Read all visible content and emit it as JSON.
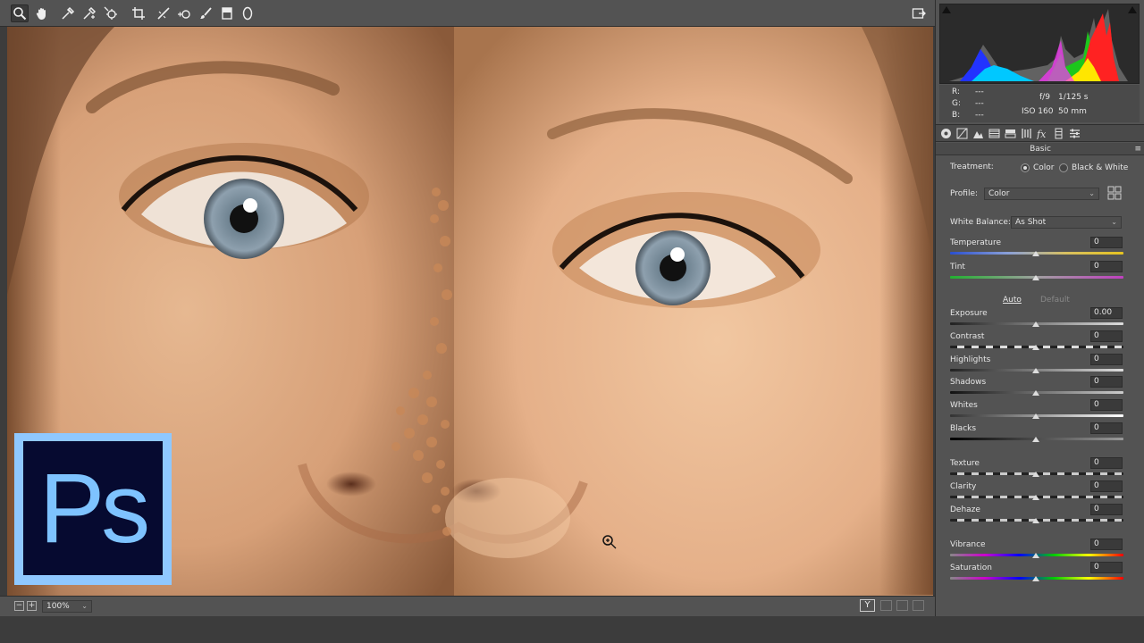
{
  "toolbar": {
    "tools": [
      "zoom-icon",
      "hand-icon",
      "white-balance-icon",
      "color-sampler-icon",
      "targeted-adjustment-icon",
      "crop-icon",
      "straighten-icon",
      "spot-removal-icon",
      "adjustment-brush-icon",
      "graduated-filter-icon",
      "radial-filter-icon"
    ],
    "fullscreen_icon": "fullscreen-toggle-icon"
  },
  "info": {
    "r_label": "R:",
    "r_value": "---",
    "g_label": "G:",
    "g_value": "---",
    "b_label": "B:",
    "b_value": "---",
    "aperture": "f/9",
    "shutter": "1/125 s",
    "iso": "ISO 160",
    "focal": "50 mm"
  },
  "panel_tabs": [
    "basic-tab-icon",
    "tone-curve-tab-icon",
    "detail-tab-icon",
    "hsl-tab-icon",
    "split-toning-tab-icon",
    "lens-tab-icon",
    "effects-tab-icon",
    "calibration-tab-icon",
    "presets-tab-icon"
  ],
  "basic": {
    "section_title": "Basic",
    "treatment_label": "Treatment:",
    "treatment_color": "Color",
    "treatment_bw": "Black & White",
    "profile_label": "Profile:",
    "profile_value": "Color",
    "wb_label": "White Balance:",
    "wb_value": "As Shot",
    "temperature": {
      "label": "Temperature",
      "value": "0"
    },
    "tint": {
      "label": "Tint",
      "value": "0"
    },
    "auto_label": "Auto",
    "default_label": "Default",
    "exposure": {
      "label": "Exposure",
      "value": "0.00"
    },
    "contrast": {
      "label": "Contrast",
      "value": "0"
    },
    "highlights": {
      "label": "Highlights",
      "value": "0"
    },
    "shadows": {
      "label": "Shadows",
      "value": "0"
    },
    "whites": {
      "label": "Whites",
      "value": "0"
    },
    "blacks": {
      "label": "Blacks",
      "value": "0"
    },
    "texture": {
      "label": "Texture",
      "value": "0"
    },
    "clarity": {
      "label": "Clarity",
      "value": "0"
    },
    "dehaze": {
      "label": "Dehaze",
      "value": "0"
    },
    "vibrance": {
      "label": "Vibrance",
      "value": "0"
    },
    "saturation": {
      "label": "Saturation",
      "value": "0"
    }
  },
  "bottom": {
    "zoom_value": "100%",
    "before_after_label": "Y"
  },
  "logo": {
    "text": "Ps"
  },
  "colors": {
    "panel_bg": "#535353",
    "logo_border": "#8fc8ff",
    "logo_bg": "#060a30",
    "logo_text": "#7ec3ff"
  }
}
